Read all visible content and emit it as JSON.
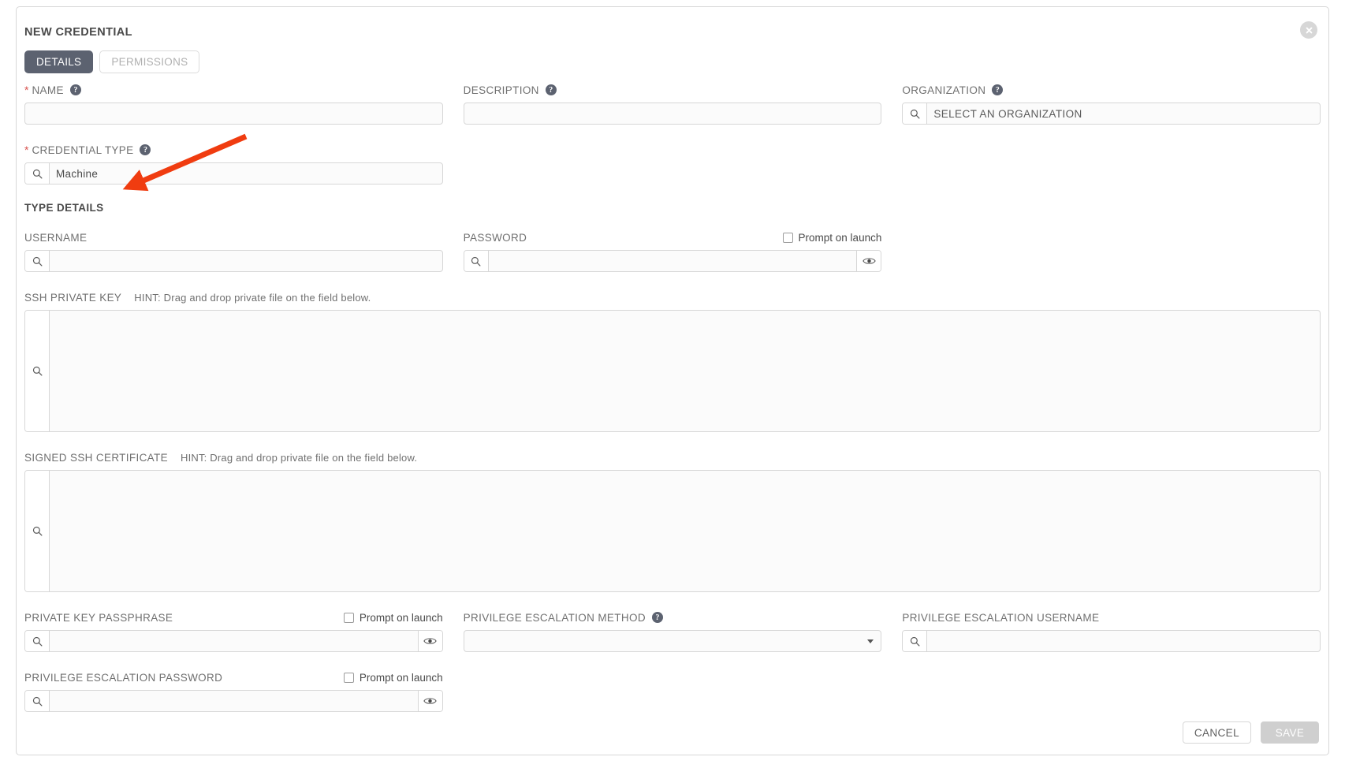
{
  "panel": {
    "title": "NEW CREDENTIAL",
    "close_icon": "close-circle-icon"
  },
  "tabs": [
    {
      "label": "DETAILS",
      "active": true
    },
    {
      "label": "PERMISSIONS",
      "active": false
    }
  ],
  "fields": {
    "name": {
      "label": "NAME",
      "required": true,
      "value": "",
      "help": "?"
    },
    "description": {
      "label": "DESCRIPTION",
      "required": false,
      "value": "",
      "help": "?"
    },
    "organization": {
      "label": "ORGANIZATION",
      "required": false,
      "placeholder": "SELECT AN ORGANIZATION",
      "value": "SELECT AN ORGANIZATION",
      "search_icon": "search-icon",
      "help": "?"
    },
    "credential_type": {
      "label": "CREDENTIAL TYPE",
      "required": true,
      "value": "Machine",
      "search_icon": "search-icon",
      "help": "?"
    }
  },
  "type_details": {
    "section_title": "TYPE DETAILS",
    "username": {
      "label": "USERNAME",
      "value": ""
    },
    "password": {
      "label": "PASSWORD",
      "value": "",
      "prompt_label": "Prompt on launch",
      "prompt_checked": false,
      "reveal_icon": "eye-icon"
    },
    "ssh_private_key": {
      "label": "SSH PRIVATE KEY",
      "hint": "HINT: Drag and drop private file on the field below.",
      "value": ""
    },
    "signed_ssh_certificate": {
      "label": "SIGNED SSH CERTIFICATE",
      "hint": "HINT: Drag and drop private file on the field below.",
      "value": ""
    },
    "private_key_passphrase": {
      "label": "PRIVATE KEY PASSPHRASE",
      "value": "",
      "prompt_label": "Prompt on launch",
      "prompt_checked": false,
      "reveal_icon": "eye-icon"
    },
    "privilege_escalation_method": {
      "label": "PRIVILEGE ESCALATION METHOD",
      "value": "",
      "help": "?"
    },
    "privilege_escalation_username": {
      "label": "PRIVILEGE ESCALATION USERNAME",
      "value": ""
    },
    "privilege_escalation_password": {
      "label": "PRIVILEGE ESCALATION PASSWORD",
      "value": "",
      "prompt_label": "Prompt on launch",
      "prompt_checked": false,
      "reveal_icon": "eye-icon"
    }
  },
  "footer": {
    "cancel_label": "CANCEL",
    "save_label": "SAVE",
    "save_disabled": true
  },
  "annotation": {
    "arrow_color": "#f03c10",
    "points_to": "credential-type-field"
  }
}
